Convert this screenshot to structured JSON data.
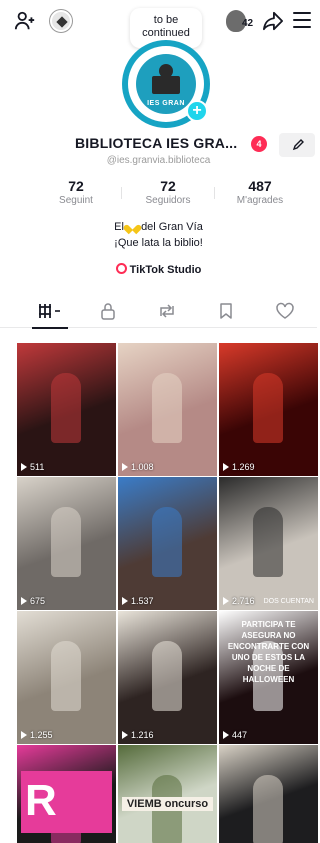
{
  "header": {
    "note_line1": "to be",
    "note_line2": "continued",
    "notification_count": "42"
  },
  "profile": {
    "avatar_text": "IES GRAN",
    "display_name": "BIBLIOTECA IES GRA...",
    "badge_count": "4",
    "username": "@ies.granvia.biblioteca",
    "bio_line1_pre": "El",
    "bio_line1_post": "del Gran Vía",
    "bio_line2": "¡Que lata la biblio!",
    "studio_label": "TikTok Studio"
  },
  "stats": [
    {
      "value": "72",
      "label": "Seguint"
    },
    {
      "value": "72",
      "label": "Seguidors"
    },
    {
      "value": "487",
      "label": "M'agrades"
    }
  ],
  "tabs": [
    {
      "name": "videos"
    },
    {
      "name": "private"
    },
    {
      "name": "reposts"
    },
    {
      "name": "favorites"
    },
    {
      "name": "liked"
    }
  ],
  "videos": [
    {
      "views": "511",
      "color": "#2a1414",
      "accent": "#c0393b"
    },
    {
      "views": "1.008",
      "color": "#b58a86",
      "accent": "#e6d3c4"
    },
    {
      "views": "1.269",
      "color": "#3a0505",
      "accent": "#d83a2a"
    },
    {
      "views": "675",
      "color": "#6f6a66",
      "accent": "#d8d2c9"
    },
    {
      "views": "1.537",
      "color": "#4e3b35",
      "accent": "#3a7cc8"
    },
    {
      "views": "2.716",
      "color": "#c9c3bb",
      "accent": "#2b2b2b"
    },
    {
      "views": "1.255",
      "color": "#8d8478",
      "accent": "#e2ddd4"
    },
    {
      "views": "1.216",
      "color": "#2e2422",
      "accent": "#e9e4da"
    },
    {
      "views": "447",
      "color": "#1c0d0f",
      "accent": "#ffffff"
    },
    {
      "views": "",
      "color": "#1a1a1a",
      "accent": "#e63b9a"
    },
    {
      "views": "",
      "color": "#cfd6c6",
      "accent": "#556b3b"
    },
    {
      "views": "",
      "color": "#1d1d1f",
      "accent": "#d9d2c6"
    }
  ],
  "overlays": {
    "v9_text": "PARTICIPA TE ASEGURA NO ENCONTRARTE CON UNO DE ESTOS LA NOCHE DE HALLOWEEN",
    "v6_text": "DOS CUENTAN",
    "v11_text": "VIEMB oncurso"
  }
}
